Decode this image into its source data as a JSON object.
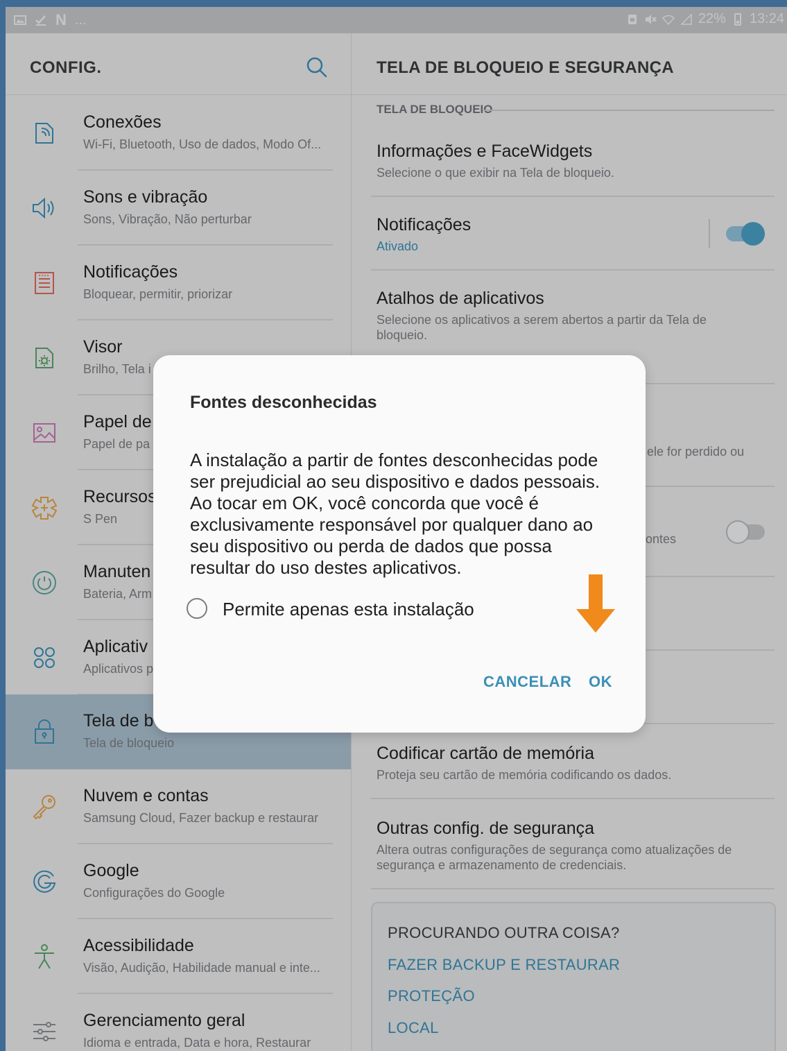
{
  "status_bar": {
    "overflow": "...",
    "battery": "22%",
    "time": "13:24"
  },
  "left_panel": {
    "title": "CONFIG.",
    "items": [
      {
        "title": "Conexões",
        "subtitle": "Wi-Fi, Bluetooth, Uso de dados, Modo Of...",
        "icon": "connections-icon"
      },
      {
        "title": "Sons e vibração",
        "subtitle": "Sons, Vibração, Não perturbar",
        "icon": "sound-icon"
      },
      {
        "title": "Notificações",
        "subtitle": "Bloquear, permitir, priorizar",
        "icon": "notifications-icon"
      },
      {
        "title": "Visor",
        "subtitle": "Brilho, Tela i",
        "icon": "display-icon"
      },
      {
        "title": "Papel de",
        "subtitle": "Papel de pa",
        "icon": "wallpaper-icon"
      },
      {
        "title": "Recursos",
        "subtitle": "S Pen",
        "icon": "advanced-features-icon"
      },
      {
        "title": "Manuten",
        "subtitle": "Bateria, Arm",
        "icon": "maintenance-icon"
      },
      {
        "title": "Aplicativ",
        "subtitle": "Aplicativos p",
        "icon": "apps-icon"
      },
      {
        "title": "Tela de b",
        "subtitle": "Tela de bloqueio",
        "icon": "lock-icon"
      },
      {
        "title": "Nuvem e contas",
        "subtitle": "Samsung Cloud, Fazer backup e restaurar",
        "icon": "key-icon"
      },
      {
        "title": "Google",
        "subtitle": "Configurações do Google",
        "icon": "google-icon"
      },
      {
        "title": "Acessibilidade",
        "subtitle": "Visão, Audição, Habilidade manual e inte...",
        "icon": "accessibility-icon"
      },
      {
        "title": "Gerenciamento geral",
        "subtitle": "Idioma e entrada, Data e hora, Restaurar",
        "icon": "sliders-icon"
      }
    ]
  },
  "right_panel": {
    "title": "TELA DE BLOQUEIO E SEGURANÇA",
    "section": "TELA DE BLOQUEIO",
    "items": {
      "face_widgets": {
        "title": "Informações e FaceWidgets",
        "subtitle": "Selecione o que exibir na Tela de bloqueio."
      },
      "notifications": {
        "title": "Notificações",
        "subtitle": "Ativado",
        "toggle_on": true
      },
      "shortcuts": {
        "title": "Atalhos de aplicativos",
        "subtitle": "Selecione os aplicativos a serem abertos a partir da Tela de bloqueio."
      },
      "partial_lost": {
        "subtitle": "ele for perdido ou"
      },
      "partial_sources": {
        "subtitle": "ontes",
        "toggle_on": false
      },
      "encrypt_card": {
        "title": "Codificar cartão de memória",
        "subtitle": "Proteja seu cartão de memória codificando os dados."
      },
      "other_security": {
        "title": "Outras config. de segurança",
        "subtitle": "Altera outras configurações de segurança como atualizações de segurança e armazenamento de credenciais."
      }
    },
    "lookup": {
      "title": "PROCURANDO OUTRA COISA?",
      "links": [
        "FAZER BACKUP E RESTAURAR",
        "PROTEÇÃO",
        "LOCAL"
      ]
    }
  },
  "dialog": {
    "title": "Fontes desconhecidas",
    "message": "A instalação a partir de fontes desconhecidas pode ser prejudicial ao seu dispositivo e dados pessoais. Ao tocar em OK, você concorda que você é exclusivamente responsável por qualquer dano ao seu dispositivo ou perda de dados que possa resultar do uso destes aplicativos.",
    "checkbox_label": "Permite apenas esta instalação",
    "checkbox_checked": false,
    "cancel": "CANCELAR",
    "ok": "OK",
    "arrow_color": "#f08a1c"
  },
  "colors": {
    "accent": "#3b8fb6",
    "toggle_on": "#4a9fc4",
    "highlight": "#aabfcf",
    "frame": "#3f6b95"
  }
}
